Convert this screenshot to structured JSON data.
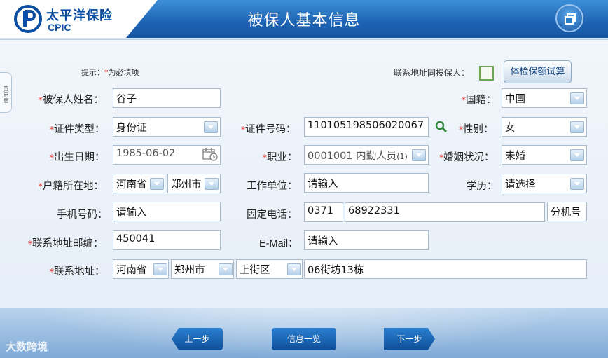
{
  "header": {
    "brand_cn": "太平洋保险",
    "brand_en": "CPIC",
    "title": "被保人基本信息"
  },
  "side_tab": {
    "label": "菜启启"
  },
  "form": {
    "hint_prefix": "提示：",
    "hint_star": "*",
    "hint_text": "为必填项",
    "same_address_label": "联系地址同投保人：",
    "calc_button": "体检保额试算",
    "name_label": "被保人姓名：",
    "name_value": "谷子",
    "nationality_label": "国籍：",
    "nationality_value": "中国",
    "id_type_label": "证件类型：",
    "id_type_value": "身份证",
    "id_number_label": "证件号码：",
    "id_number_value": "110105198506020067",
    "gender_label": "性别：",
    "gender_value": "女",
    "birth_label": "出生日期：",
    "birth_value": "1985-06-02",
    "occupation_label": "职业：",
    "occupation_value": "0001001 内勤人员",
    "occupation_level": "(1)",
    "marital_label": "婚姻状况：",
    "marital_value": "未婚",
    "household_label": "户籍所在地：",
    "household_province": "河南省",
    "household_city": "郑州市",
    "employer_label": "工作单位：",
    "employer_placeholder": "请输入",
    "education_label": "学历：",
    "education_value": "请选择",
    "mobile_label": "手机号码：",
    "mobile_placeholder": "请输入",
    "phone_label": "固定电话：",
    "phone_area": "0371",
    "phone_number": "68922331",
    "phone_ext": "分机号",
    "zip_label": "联系地址邮编：",
    "zip_value": "450041",
    "email_label": "E-Mail：",
    "email_placeholder": "请输入",
    "address_label": "联系地址：",
    "address_province": "河南省",
    "address_city": "郑州市",
    "address_district": "上街区",
    "address_detail": "06街坊13栋"
  },
  "footer": {
    "prev": "上一步",
    "overview": "信息一览",
    "next": "下一步",
    "watermark": "大数跨境"
  },
  "colors": {
    "header_blue": "#1d63b3",
    "required_star": "#e2231a",
    "checkbox_green": "#6aa84f"
  }
}
